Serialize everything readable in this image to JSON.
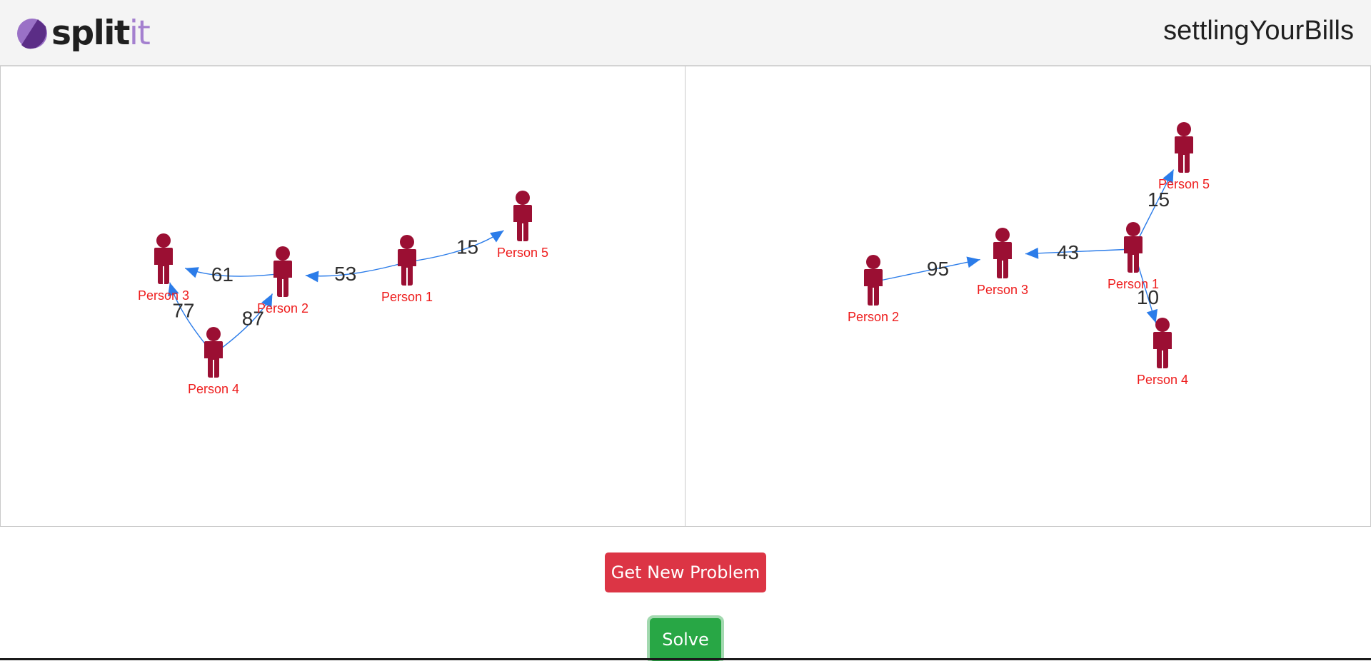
{
  "brand": {
    "logo_text_main": "split",
    "logo_text_accent": "it",
    "title": "settlingYourBills",
    "colors": {
      "navbar_bg": "#f4f4f4",
      "logo_mark": "#7b4aa6",
      "logo_accent": "#a480cf"
    }
  },
  "colors": {
    "edge": "#2b7ce9",
    "node": "#9b0f33",
    "node_label": "#ee1c1c"
  },
  "graphs": [
    {
      "name": "problem",
      "nodes": [
        {
          "id": "n1",
          "label": "Person 1"
        },
        {
          "id": "n2",
          "label": "Person 2"
        },
        {
          "id": "n3",
          "label": "Person 3"
        },
        {
          "id": "n4",
          "label": "Person 4"
        },
        {
          "id": "n5",
          "label": "Person 5"
        }
      ],
      "edges": [
        {
          "from": "n1",
          "to": "n5",
          "amount": "15"
        },
        {
          "from": "n1",
          "to": "n2",
          "amount": "53"
        },
        {
          "from": "n2",
          "to": "n3",
          "amount": "61"
        },
        {
          "from": "n4",
          "to": "n3",
          "amount": "77"
        },
        {
          "from": "n4",
          "to": "n2",
          "amount": "87"
        }
      ]
    },
    {
      "name": "solution",
      "nodes": [
        {
          "id": "n1",
          "label": "Person 1"
        },
        {
          "id": "n2",
          "label": "Person 2"
        },
        {
          "id": "n3",
          "label": "Person 3"
        },
        {
          "id": "n4",
          "label": "Person 4"
        },
        {
          "id": "n5",
          "label": "Person 5"
        }
      ],
      "edges": [
        {
          "from": "n2",
          "to": "n3",
          "amount": "95"
        },
        {
          "from": "n1",
          "to": "n3",
          "amount": "43"
        },
        {
          "from": "n1",
          "to": "n5",
          "amount": "15"
        },
        {
          "from": "n1",
          "to": "n4",
          "amount": "10"
        }
      ]
    }
  ],
  "buttons": {
    "new_problem": "Get New Problem",
    "solve": "Solve"
  }
}
